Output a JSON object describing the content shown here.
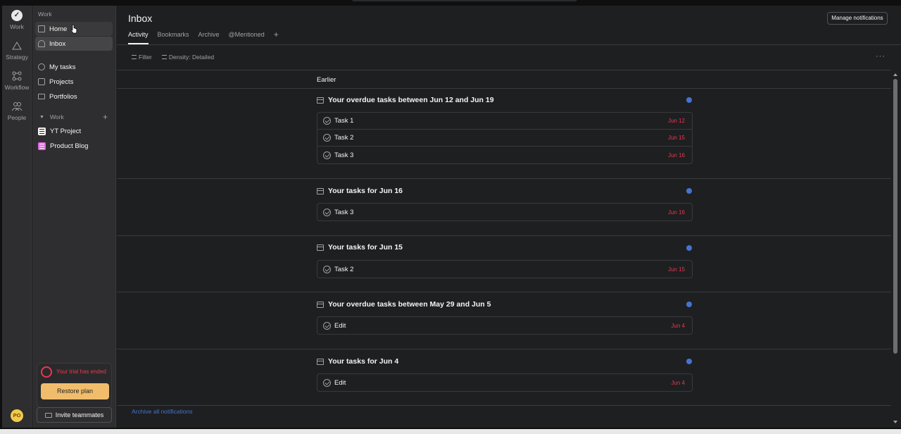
{
  "rail": {
    "items": [
      {
        "label": "Work",
        "icon": "check-circle-icon"
      },
      {
        "label": "Strategy",
        "icon": "triangle-icon"
      },
      {
        "label": "Workflow",
        "icon": "workflow-icon"
      },
      {
        "label": "People",
        "icon": "people-icon"
      }
    ],
    "avatar_initials": "PO"
  },
  "sidebar": {
    "workspace_label": "Work",
    "nav": [
      {
        "label": "Home",
        "icon": "home-icon"
      },
      {
        "label": "Inbox",
        "icon": "bell-icon"
      }
    ],
    "items": [
      {
        "label": "My tasks",
        "icon": "check-circle-icon"
      },
      {
        "label": "Projects",
        "icon": "clipboard-icon"
      },
      {
        "label": "Portfolios",
        "icon": "folder-icon"
      }
    ],
    "section_label": "Work",
    "projects": [
      {
        "label": "YT Project",
        "color": "#f5f4f3"
      },
      {
        "label": "Product Blog",
        "color": "#e362e3"
      }
    ],
    "trial_text": "Your trial has ended",
    "restore_label": "Restore plan",
    "invite_label": "Invite teammates"
  },
  "main": {
    "title": "Inbox",
    "manage_label": "Manage notifications",
    "tabs": [
      {
        "label": "Activity"
      },
      {
        "label": "Bookmarks"
      },
      {
        "label": "Archive"
      },
      {
        "label": "@Mentioned"
      }
    ],
    "tab_add": "+",
    "toolbar": {
      "filter_label": "Filter",
      "density_label": "Density: Detailed",
      "more_label": "···"
    },
    "section_label": "Earlier",
    "groups": [
      {
        "title": "Your overdue tasks between Jun 12 and Jun 19",
        "tasks": [
          {
            "name": "Task 1",
            "date": "Jun 12"
          },
          {
            "name": "Task 2",
            "date": "Jun 15"
          },
          {
            "name": "Task 3",
            "date": "Jun 16"
          }
        ]
      },
      {
        "title": "Your tasks for Jun 16",
        "tasks": [
          {
            "name": "Task 3",
            "date": "Jun 16"
          }
        ]
      },
      {
        "title": "Your tasks for Jun 15",
        "tasks": [
          {
            "name": "Task 2",
            "date": "Jun 15"
          }
        ]
      },
      {
        "title": "Your overdue tasks between May 29 and Jun 5",
        "tasks": [
          {
            "name": "Edit",
            "date": "Jun 4"
          }
        ]
      },
      {
        "title": "Your tasks for Jun 4",
        "tasks": [
          {
            "name": "Edit",
            "date": "Jun 4"
          }
        ]
      }
    ],
    "archive_all_label": "Archive all notifications"
  },
  "colors": {
    "background": "#1e1f21",
    "sidebar": "#2e2e30",
    "due_date": "#e8384f",
    "unread_dot": "#4573d2",
    "restore_button": "#f1bd6c"
  }
}
